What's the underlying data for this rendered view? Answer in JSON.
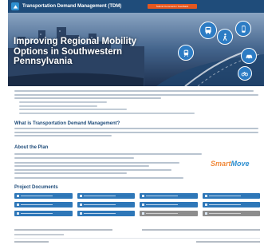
{
  "header": {
    "title": "Transportation Demand Management (TDM)",
    "cta_label": "Submit Comments / Feedback"
  },
  "hero": {
    "title": "Improving Regional Mobility Options in Southwestern Pennsylvania",
    "icons": [
      "bus-icon",
      "pedestrian-icon",
      "phone-icon",
      "train-icon",
      "car-icon",
      "bicycle-icon"
    ]
  },
  "sections": {
    "what_is": "What is Transportation Demand Management?",
    "about": "About the Plan",
    "documents": "Project Documents"
  },
  "brand": {
    "smart": "Smart",
    "move": "Move"
  },
  "colors": {
    "navy": "#1f4c7a",
    "accent_orange": "#e4571f",
    "button_blue": "#2e77b8"
  }
}
